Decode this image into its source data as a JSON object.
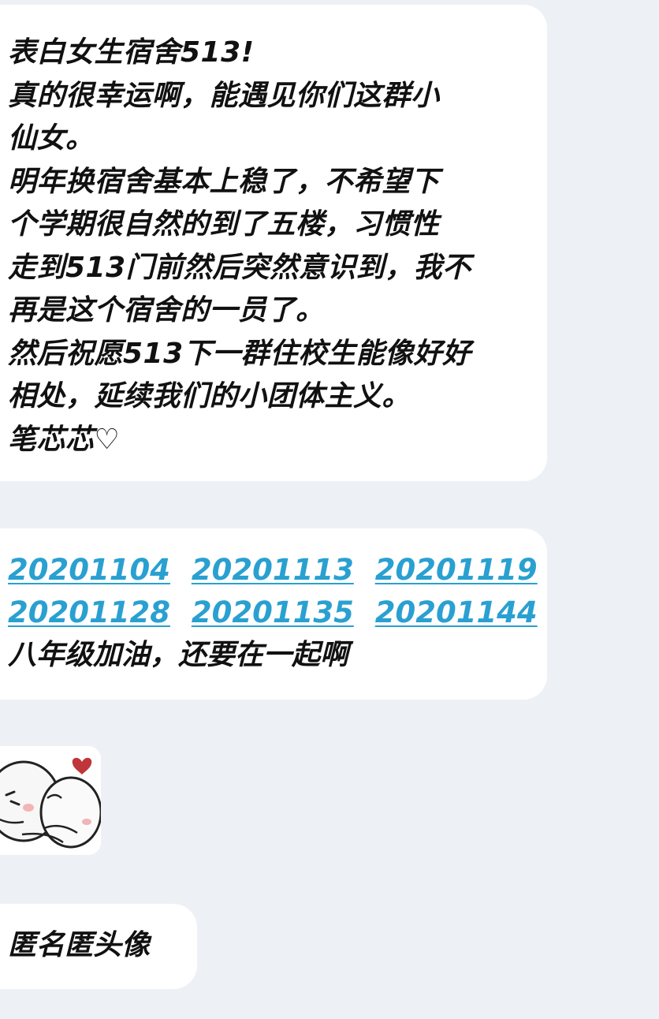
{
  "messages": [
    {
      "lines": [
        "表白女生宿舍513!",
        "真的很幸运啊，能遇见你们这群小",
        "仙女。",
        "明年换宿舍基本上稳了，不希望下",
        "个学期很自然的到了五楼，习惯性",
        "走到513门前然后突然意识到，我不",
        "再是这个宿舍的一员了。",
        "然后祝愿513下一群住校生能像好好",
        "相处，延续我们的小团体主义。",
        "笔芯芯♡"
      ]
    },
    {
      "link_rows": [
        [
          "20201104",
          "20201113",
          "20201119"
        ],
        [
          "20201128",
          "20201135",
          "20201144"
        ]
      ],
      "text": "八年级加油，还要在一起啊",
      "link_color": "#2aa0d1"
    },
    {
      "sticker": "hugging-cartoon-sticker"
    },
    {
      "text": "匿名匿头像"
    }
  ],
  "colors": {
    "background": "#edf1f6",
    "bubble": "#ffffff",
    "heart": "#c0353a"
  }
}
